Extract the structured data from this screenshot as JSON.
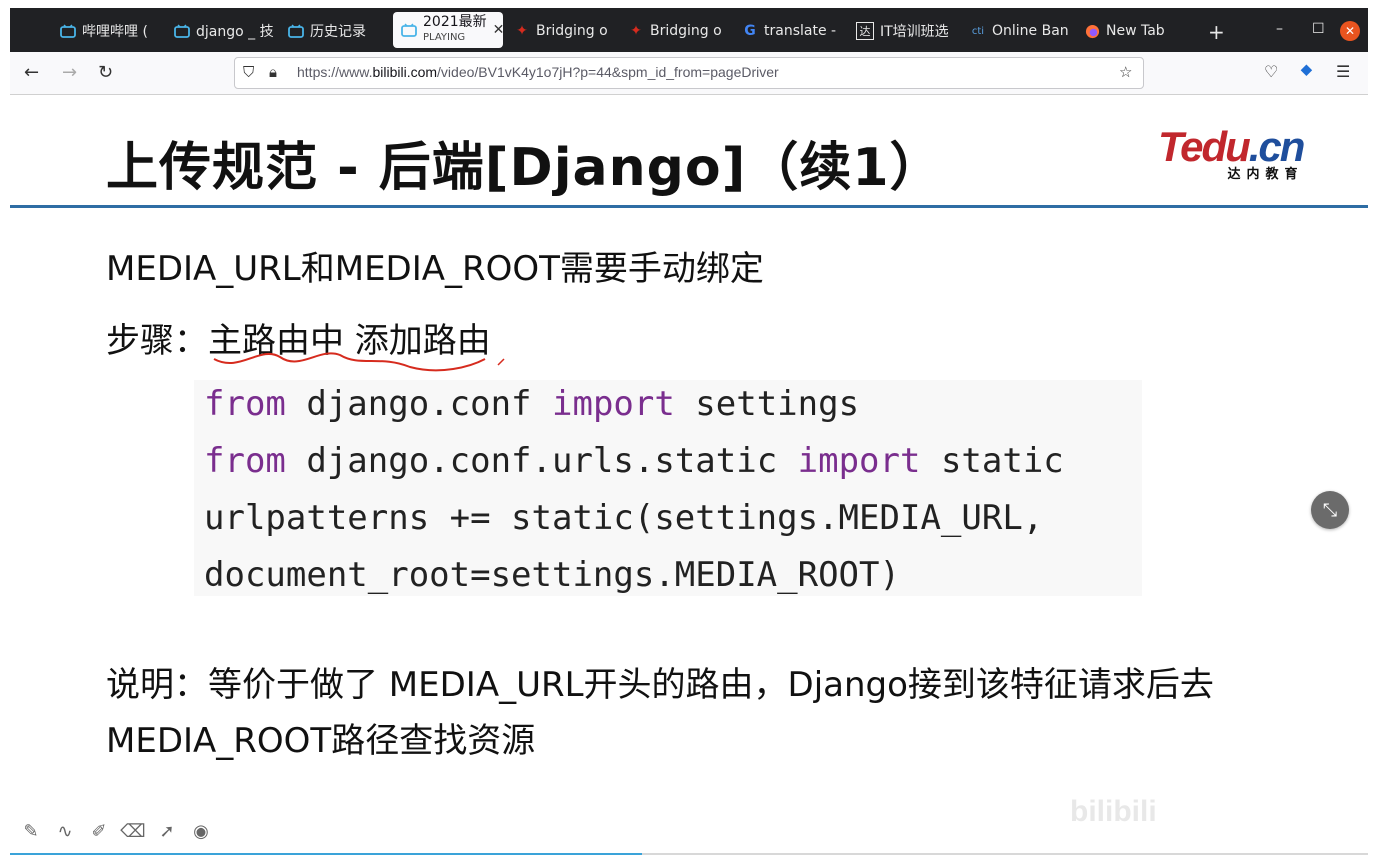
{
  "browser": {
    "tabs": [
      {
        "label": "哔哩哔哩 (",
        "icon": "bilibili-icon"
      },
      {
        "label": "django _ 技",
        "icon": "bilibili-icon"
      },
      {
        "label": "历史记录",
        "icon": "bilibili-icon"
      },
      {
        "label": "2021最新",
        "sublabel": "PLAYING",
        "icon": "bilibili-icon",
        "active": true
      },
      {
        "label": "Bridging o",
        "icon": "maple-leaf-icon"
      },
      {
        "label": "Bridging o",
        "icon": "maple-leaf-icon"
      },
      {
        "label": "translate -",
        "icon": "google-icon"
      },
      {
        "label": "IT培训班选",
        "icon": "da-icon"
      },
      {
        "label": "Online Ban",
        "icon": "cti-icon"
      },
      {
        "label": "New Tab",
        "icon": "firefox-icon"
      }
    ],
    "url_prefix": "https://www.",
    "url_domain": "bilibili.com",
    "url_rest": "/video/BV1vK4y1o7jH?p=44&spm_id_from=pageDriver"
  },
  "slide": {
    "title": "上传规范 - 后端[Django]（续1）",
    "logo_text": "Tedu",
    "logo_suffix": ".cn",
    "logo_sub": "达内教育",
    "line1": "MEDIA_URL和MEDIA_ROOT需要手动绑定",
    "line2": "步骤：主路由中 添加路由",
    "code": [
      {
        "kw": "from",
        "rest1": " django.conf ",
        "kw2": "import",
        "rest2": " settings"
      },
      {
        "kw": "from",
        "rest1": " django.conf.urls.static ",
        "kw2": "import",
        "rest2": " static"
      },
      {
        "kw": "",
        "rest1": "urlpatterns += static(settings.MEDIA_URL,",
        "kw2": "",
        "rest2": ""
      },
      {
        "kw": "",
        "rest1": "document_root=settings.MEDIA_ROOT)",
        "kw2": "",
        "rest2": ""
      }
    ],
    "note1": "说明：等价于做了 MEDIA_URL开头的路由，Django接到该特征请求后去",
    "note2": "MEDIA_ROOT路径查找资源"
  },
  "watermark": "bilibili",
  "colors": {
    "keyword": "#7a2e8e",
    "accent": "#2e6da4",
    "logo_red": "#c1272d"
  }
}
